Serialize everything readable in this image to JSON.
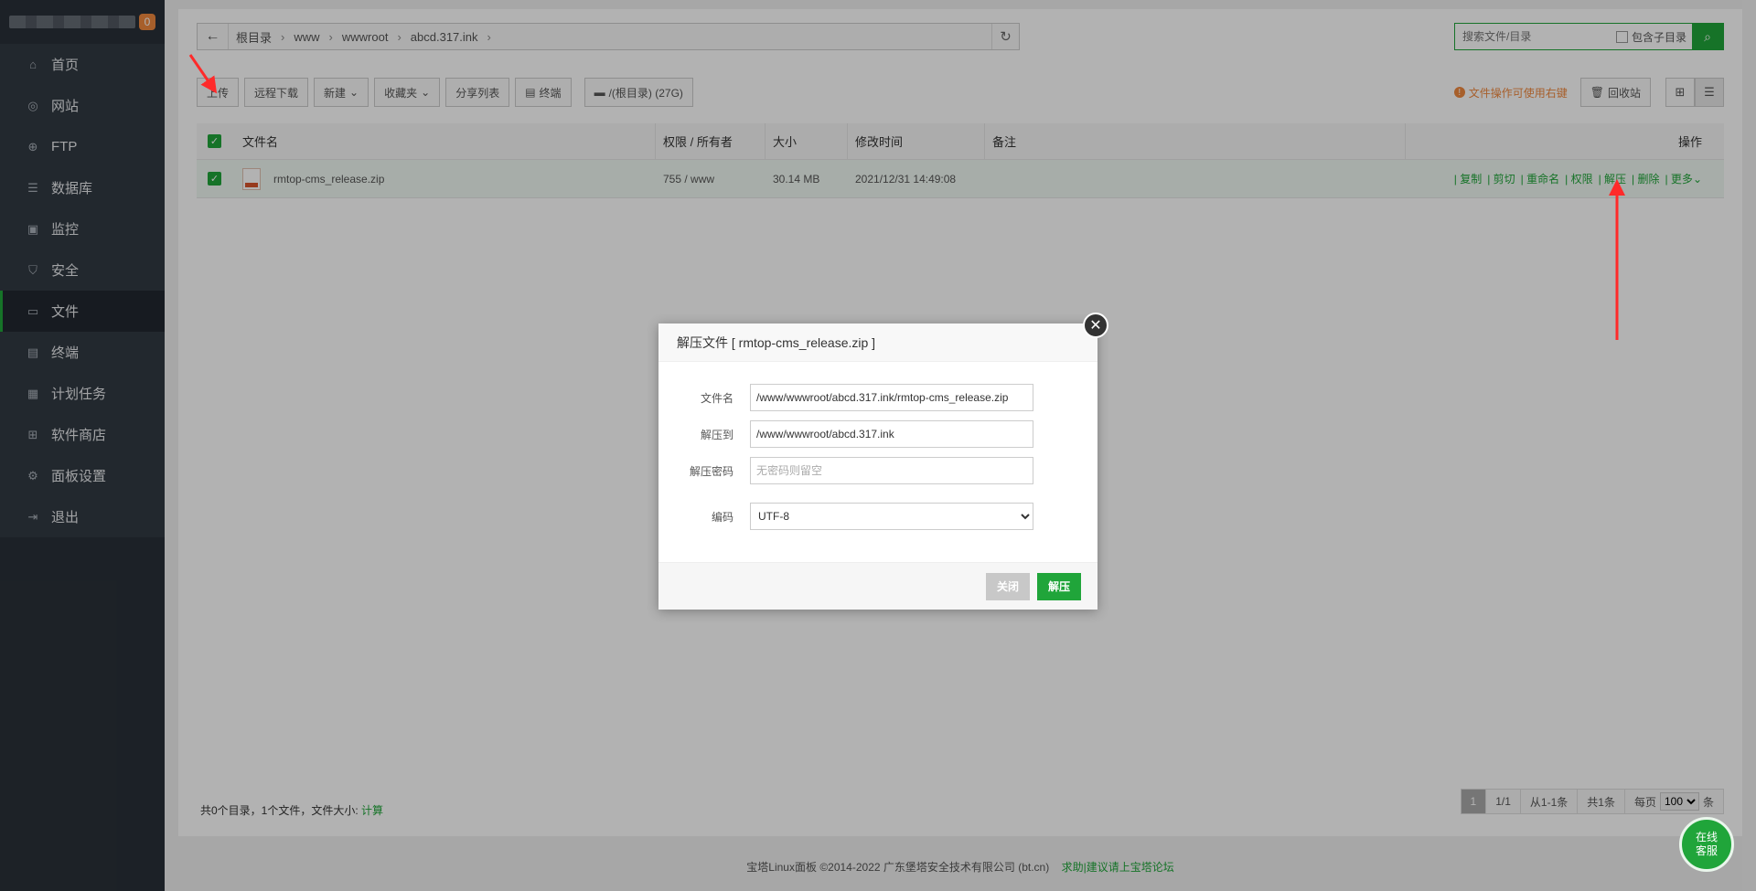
{
  "sidebar": {
    "badge": "0",
    "items": [
      {
        "label": "首页",
        "icon": "home-icon"
      },
      {
        "label": "网站",
        "icon": "globe-icon"
      },
      {
        "label": "FTP",
        "icon": "ftp-icon"
      },
      {
        "label": "数据库",
        "icon": "database-icon"
      },
      {
        "label": "监控",
        "icon": "monitor-icon"
      },
      {
        "label": "安全",
        "icon": "shield-icon"
      },
      {
        "label": "文件",
        "icon": "folder-icon",
        "active": true
      },
      {
        "label": "终端",
        "icon": "terminal-icon"
      },
      {
        "label": "计划任务",
        "icon": "calendar-icon"
      },
      {
        "label": "软件商店",
        "icon": "apps-icon"
      },
      {
        "label": "面板设置",
        "icon": "gear-icon"
      },
      {
        "label": "退出",
        "icon": "logout-icon"
      }
    ]
  },
  "breadcrumb": [
    "根目录",
    "www",
    "wwwroot",
    "abcd.317.ink"
  ],
  "search": {
    "placeholder": "搜索文件/目录",
    "include_sub": "包含子目录"
  },
  "toolbar": {
    "upload": "上传",
    "remote_download": "远程下载",
    "new": "新建",
    "favorites": "收藏夹",
    "share_list": "分享列表",
    "terminal": "终端",
    "disk": "/(根目录) (27G)"
  },
  "right_tools": {
    "tip": "文件操作可使用右键",
    "recycle": "回收站"
  },
  "table": {
    "headers": {
      "name": "文件名",
      "perm": "权限 / 所有者",
      "size": "大小",
      "mtime": "修改时间",
      "note": "备注",
      "ops": "操作"
    },
    "rows": [
      {
        "name": "rmtop-cms_release.zip",
        "perm": "755 / www",
        "size": "30.14 MB",
        "mtime": "2021/12/31 14:49:08",
        "note": ""
      }
    ],
    "ops": [
      "| 复制",
      "| 剪切",
      "| 重命名",
      "| 权限",
      "| 解压",
      "| 删除",
      "| 更多"
    ]
  },
  "footer": {
    "summary": "共0个目录，1个文件，文件大小:",
    "calc": "计算",
    "pager": {
      "current": "1",
      "pages": "1/1",
      "range": "从1-1条",
      "total": "共1条",
      "per_page_label": "每页",
      "per_page": "100",
      "unit": "条"
    }
  },
  "copyright": {
    "text": "宝塔Linux面板 ©2014-2022 广东堡塔安全技术有限公司 (bt.cn)",
    "link": "求助|建议请上宝塔论坛"
  },
  "float_btn": {
    "line1": "在线",
    "line2": "客服"
  },
  "dialog": {
    "title": "解压文件 [ rmtop-cms_release.zip ]",
    "filename_label": "文件名",
    "filename_value": "/www/wwwroot/abcd.317.ink/rmtop-cms_release.zip",
    "dest_label": "解压到",
    "dest_value": "/www/wwwroot/abcd.317.ink",
    "password_label": "解压密码",
    "password_placeholder": "无密码则留空",
    "encoding_label": "编码",
    "encoding_value": "UTF-8",
    "close_btn": "关闭",
    "extract_btn": "解压"
  },
  "colors": {
    "accent": "#20a53a",
    "sidebar_bg": "#293038",
    "arrow": "#ff2a2a"
  }
}
